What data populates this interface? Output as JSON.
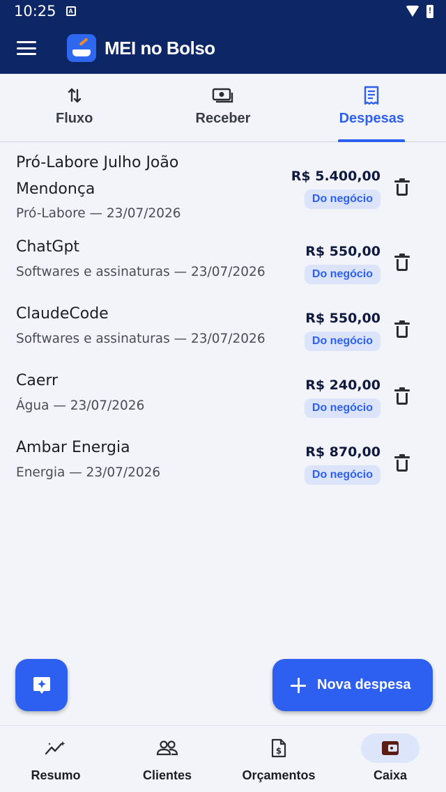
{
  "status_bar": {
    "time": "10:25",
    "notification_letter": "A"
  },
  "app_bar": {
    "title": "MEI no Bolso"
  },
  "tabs": [
    {
      "label": "Fluxo",
      "icon": "swap-vertical-icon",
      "active": false
    },
    {
      "label": "Receber",
      "icon": "cash-icon",
      "active": false
    },
    {
      "label": "Despesas",
      "icon": "receipt-icon",
      "active": true
    }
  ],
  "expenses": [
    {
      "title_line1": "Pró-Labore Julho João",
      "title_line2": "Mendonça",
      "subtitle": "Pró-Labore — 23/07/2026",
      "amount": "R$ 5.400,00",
      "badge": "Do negócio"
    },
    {
      "title_line1": "ChatGpt",
      "subtitle": "Softwares e assinaturas — 23/07/2026",
      "amount": "R$ 550,00",
      "badge": "Do negócio"
    },
    {
      "title_line1": "ClaudeCode",
      "subtitle": "Softwares e assinaturas — 23/07/2026",
      "amount": "R$ 550,00",
      "badge": "Do negócio"
    },
    {
      "title_line1": "Caerr",
      "subtitle": "Água — 23/07/2026",
      "amount": "R$ 240,00",
      "badge": "Do negócio"
    },
    {
      "title_line1": "Ambar Energia",
      "subtitle": "Energia — 23/07/2026",
      "amount": "R$ 870,00",
      "badge": "Do negócio"
    }
  ],
  "fab": {
    "new_expense_label": "Nova despesa",
    "assistant_icon": "sparkle-chat-icon"
  },
  "bottom_nav": [
    {
      "label": "Resumo",
      "icon": "trend-sparkle-icon",
      "active": false
    },
    {
      "label": "Clientes",
      "icon": "people-icon",
      "active": false
    },
    {
      "label": "Orçamentos",
      "icon": "invoice-icon",
      "active": false
    },
    {
      "label": "Caixa",
      "icon": "wallet-icon",
      "active": true
    }
  ],
  "colors": {
    "header": "#0d2766",
    "accent": "#2d5ff0",
    "background": "#f3f4f9",
    "badge_bg": "#dce4fb"
  }
}
